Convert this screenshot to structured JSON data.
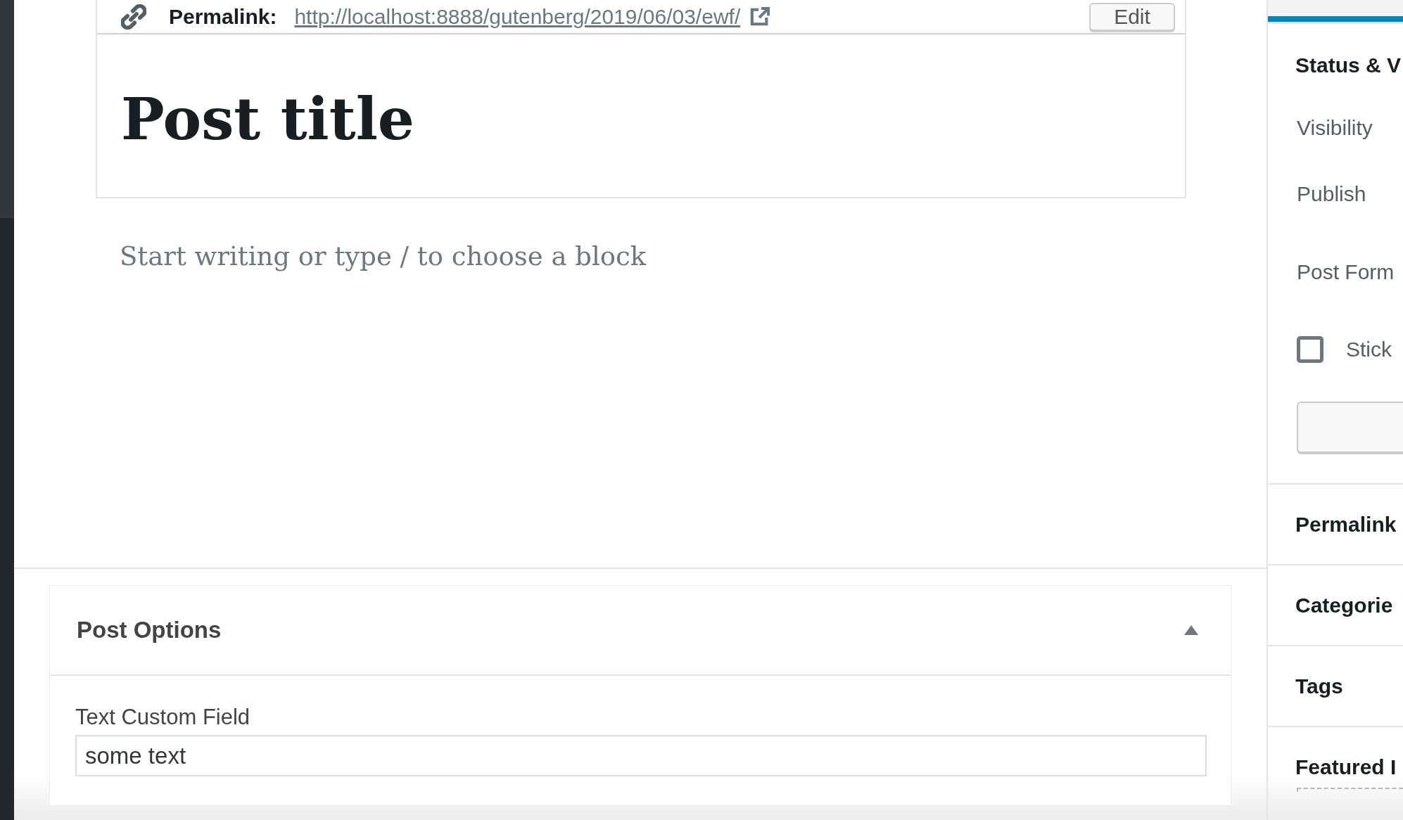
{
  "editor": {
    "permalink": {
      "label": "Permalink:",
      "url": "http://localhost:8888/gutenberg/2019/06/03/ewf/",
      "edit_button": "Edit"
    },
    "title": {
      "value": "Post title"
    },
    "paragraph_block": {
      "placeholder": "Start writing or type / to choose a block"
    }
  },
  "meta_boxes": [
    {
      "title": "Post Options",
      "expanded": true,
      "fields": [
        {
          "label": "Text Custom Field",
          "value": "some text"
        }
      ]
    }
  ],
  "sidebar": {
    "panels": [
      {
        "title": "Status & V",
        "rows": [
          {
            "kind": "setting",
            "label": "Visibility"
          },
          {
            "kind": "setting",
            "label": "Publish"
          },
          {
            "kind": "setting",
            "label": "Post Form"
          },
          {
            "kind": "checkbox",
            "label": "Stick",
            "checked": false
          },
          {
            "kind": "button"
          }
        ]
      },
      {
        "title": "Permalink"
      },
      {
        "title": "Categorie"
      },
      {
        "title": "Tags"
      },
      {
        "title": "Featured I",
        "rows": [
          {
            "kind": "dropzone"
          }
        ]
      }
    ]
  }
}
